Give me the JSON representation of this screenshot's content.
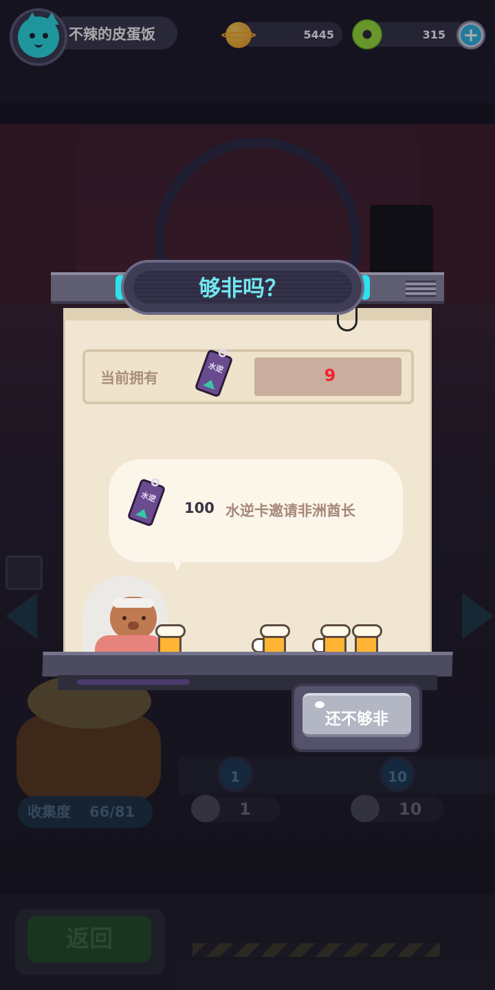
{
  "player": {
    "name": "不辣的皮蛋饭",
    "avatar_icon": "cat-avatar-icon"
  },
  "currencies": {
    "coins": {
      "icon": "planet-coin-icon",
      "value": "5445"
    },
    "donuts": {
      "icon": "donut-icon",
      "value": "315"
    }
  },
  "dialog": {
    "title": "够非吗？",
    "owned_label": "当前拥有",
    "owned_value": "9",
    "card_text": "水逆",
    "offer_count": "100",
    "offer_text": "水逆卡邀请非洲酋长",
    "button_label": "还不够非"
  },
  "background": {
    "draw_buttons": [
      {
        "label": "1"
      },
      {
        "label": "10"
      }
    ],
    "draw_costs": [
      {
        "value": "1"
      },
      {
        "value": "10"
      }
    ],
    "collection_label": "收集度",
    "collection_value": "66/81",
    "back_label": "返回"
  },
  "colors": {
    "owned_value": "#f5222d",
    "title": "#73e6f0",
    "accent_cyan": "#2ee1ec",
    "paper": "#f0e6d1"
  }
}
